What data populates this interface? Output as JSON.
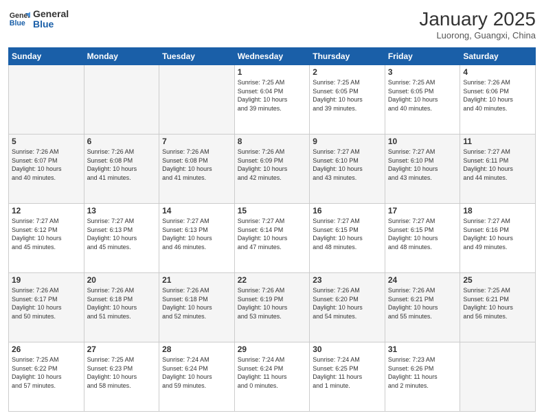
{
  "logo": {
    "line1": "General",
    "line2": "Blue"
  },
  "title": "January 2025",
  "location": "Luorong, Guangxi, China",
  "days_header": [
    "Sunday",
    "Monday",
    "Tuesday",
    "Wednesday",
    "Thursday",
    "Friday",
    "Saturday"
  ],
  "weeks": [
    [
      {
        "day": "",
        "info": ""
      },
      {
        "day": "",
        "info": ""
      },
      {
        "day": "",
        "info": ""
      },
      {
        "day": "1",
        "info": "Sunrise: 7:25 AM\nSunset: 6:04 PM\nDaylight: 10 hours\nand 39 minutes."
      },
      {
        "day": "2",
        "info": "Sunrise: 7:25 AM\nSunset: 6:05 PM\nDaylight: 10 hours\nand 39 minutes."
      },
      {
        "day": "3",
        "info": "Sunrise: 7:25 AM\nSunset: 6:05 PM\nDaylight: 10 hours\nand 40 minutes."
      },
      {
        "day": "4",
        "info": "Sunrise: 7:26 AM\nSunset: 6:06 PM\nDaylight: 10 hours\nand 40 minutes."
      }
    ],
    [
      {
        "day": "5",
        "info": "Sunrise: 7:26 AM\nSunset: 6:07 PM\nDaylight: 10 hours\nand 40 minutes."
      },
      {
        "day": "6",
        "info": "Sunrise: 7:26 AM\nSunset: 6:08 PM\nDaylight: 10 hours\nand 41 minutes."
      },
      {
        "day": "7",
        "info": "Sunrise: 7:26 AM\nSunset: 6:08 PM\nDaylight: 10 hours\nand 41 minutes."
      },
      {
        "day": "8",
        "info": "Sunrise: 7:26 AM\nSunset: 6:09 PM\nDaylight: 10 hours\nand 42 minutes."
      },
      {
        "day": "9",
        "info": "Sunrise: 7:27 AM\nSunset: 6:10 PM\nDaylight: 10 hours\nand 43 minutes."
      },
      {
        "day": "10",
        "info": "Sunrise: 7:27 AM\nSunset: 6:10 PM\nDaylight: 10 hours\nand 43 minutes."
      },
      {
        "day": "11",
        "info": "Sunrise: 7:27 AM\nSunset: 6:11 PM\nDaylight: 10 hours\nand 44 minutes."
      }
    ],
    [
      {
        "day": "12",
        "info": "Sunrise: 7:27 AM\nSunset: 6:12 PM\nDaylight: 10 hours\nand 45 minutes."
      },
      {
        "day": "13",
        "info": "Sunrise: 7:27 AM\nSunset: 6:13 PM\nDaylight: 10 hours\nand 45 minutes."
      },
      {
        "day": "14",
        "info": "Sunrise: 7:27 AM\nSunset: 6:13 PM\nDaylight: 10 hours\nand 46 minutes."
      },
      {
        "day": "15",
        "info": "Sunrise: 7:27 AM\nSunset: 6:14 PM\nDaylight: 10 hours\nand 47 minutes."
      },
      {
        "day": "16",
        "info": "Sunrise: 7:27 AM\nSunset: 6:15 PM\nDaylight: 10 hours\nand 48 minutes."
      },
      {
        "day": "17",
        "info": "Sunrise: 7:27 AM\nSunset: 6:15 PM\nDaylight: 10 hours\nand 48 minutes."
      },
      {
        "day": "18",
        "info": "Sunrise: 7:27 AM\nSunset: 6:16 PM\nDaylight: 10 hours\nand 49 minutes."
      }
    ],
    [
      {
        "day": "19",
        "info": "Sunrise: 7:26 AM\nSunset: 6:17 PM\nDaylight: 10 hours\nand 50 minutes."
      },
      {
        "day": "20",
        "info": "Sunrise: 7:26 AM\nSunset: 6:18 PM\nDaylight: 10 hours\nand 51 minutes."
      },
      {
        "day": "21",
        "info": "Sunrise: 7:26 AM\nSunset: 6:18 PM\nDaylight: 10 hours\nand 52 minutes."
      },
      {
        "day": "22",
        "info": "Sunrise: 7:26 AM\nSunset: 6:19 PM\nDaylight: 10 hours\nand 53 minutes."
      },
      {
        "day": "23",
        "info": "Sunrise: 7:26 AM\nSunset: 6:20 PM\nDaylight: 10 hours\nand 54 minutes."
      },
      {
        "day": "24",
        "info": "Sunrise: 7:26 AM\nSunset: 6:21 PM\nDaylight: 10 hours\nand 55 minutes."
      },
      {
        "day": "25",
        "info": "Sunrise: 7:25 AM\nSunset: 6:21 PM\nDaylight: 10 hours\nand 56 minutes."
      }
    ],
    [
      {
        "day": "26",
        "info": "Sunrise: 7:25 AM\nSunset: 6:22 PM\nDaylight: 10 hours\nand 57 minutes."
      },
      {
        "day": "27",
        "info": "Sunrise: 7:25 AM\nSunset: 6:23 PM\nDaylight: 10 hours\nand 58 minutes."
      },
      {
        "day": "28",
        "info": "Sunrise: 7:24 AM\nSunset: 6:24 PM\nDaylight: 10 hours\nand 59 minutes."
      },
      {
        "day": "29",
        "info": "Sunrise: 7:24 AM\nSunset: 6:24 PM\nDaylight: 11 hours\nand 0 minutes."
      },
      {
        "day": "30",
        "info": "Sunrise: 7:24 AM\nSunset: 6:25 PM\nDaylight: 11 hours\nand 1 minute."
      },
      {
        "day": "31",
        "info": "Sunrise: 7:23 AM\nSunset: 6:26 PM\nDaylight: 11 hours\nand 2 minutes."
      },
      {
        "day": "",
        "info": ""
      }
    ]
  ]
}
